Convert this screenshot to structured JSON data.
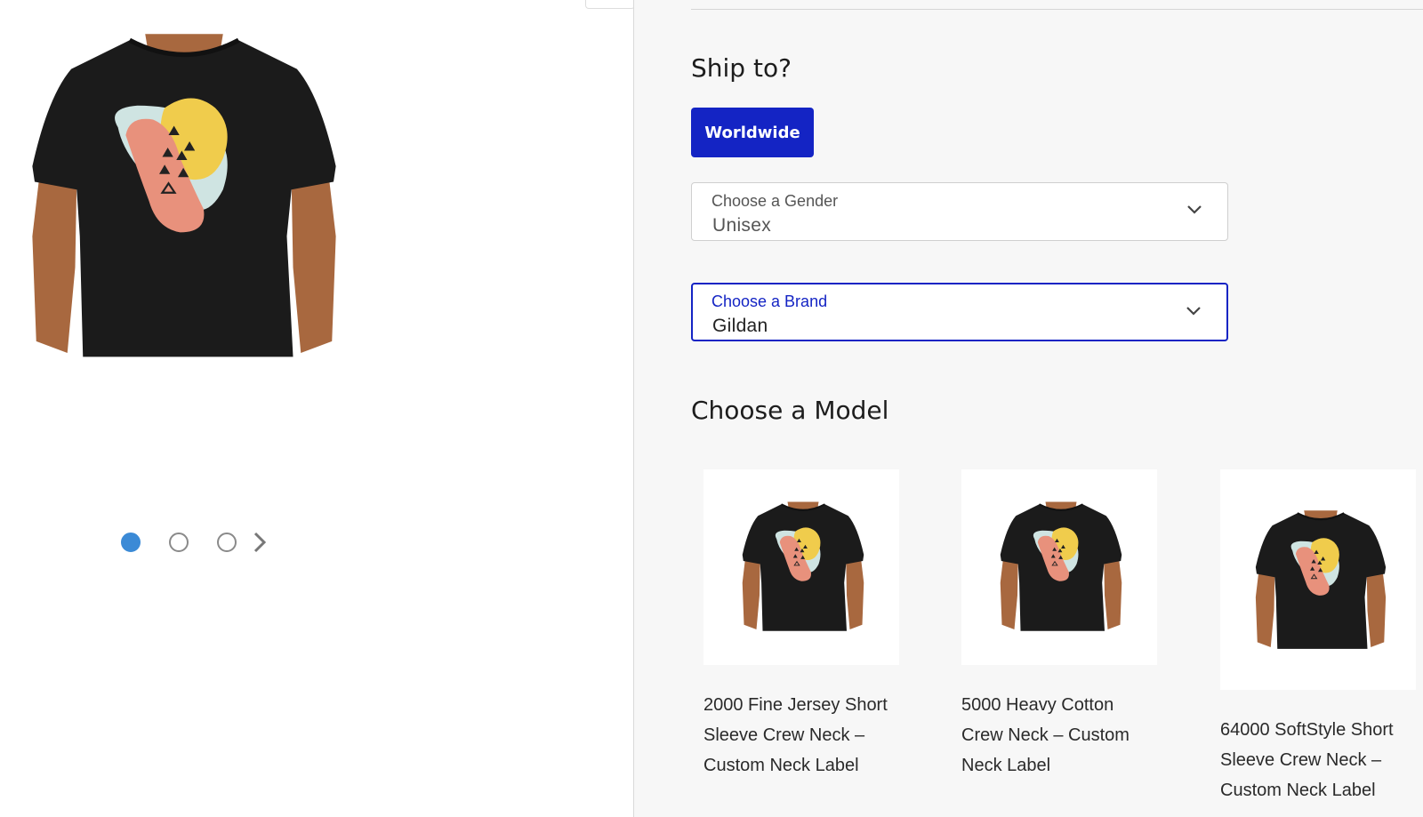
{
  "gallery": {
    "dots": [
      {
        "label": "slide-1",
        "active": true
      },
      {
        "label": "slide-2",
        "active": false
      },
      {
        "label": "slide-3",
        "active": false
      }
    ],
    "next_icon": "chevron-right-icon"
  },
  "ship": {
    "title": "Ship to?",
    "button_label": "Worldwide",
    "button_color": "#1424c4"
  },
  "gender_select": {
    "label": "Choose a Gender",
    "value": "Unisex",
    "icon": "chevron-down-icon"
  },
  "brand_select": {
    "label": "Choose a Brand",
    "value": "Gildan",
    "icon": "chevron-down-icon",
    "focus_color": "#1424c4"
  },
  "models": {
    "title": "Choose a Model",
    "items": [
      {
        "name": "2000 Fine Jersey Short Sleeve Crew Neck – Custom Neck Label"
      },
      {
        "name": "5000 Heavy Cotton Crew Neck – Custom Neck Label"
      },
      {
        "name": "64000 SoftStyle Short Sleeve Crew Neck – Custom Neck Label"
      }
    ]
  },
  "colors": {
    "shirt": "#1b1b1b",
    "skin": "#a8683f",
    "blob_yellow": "#f0cc4c",
    "blob_pink": "#e8917c",
    "blob_mint": "#cfe4e2",
    "dot_active": "#3b8ad6"
  }
}
